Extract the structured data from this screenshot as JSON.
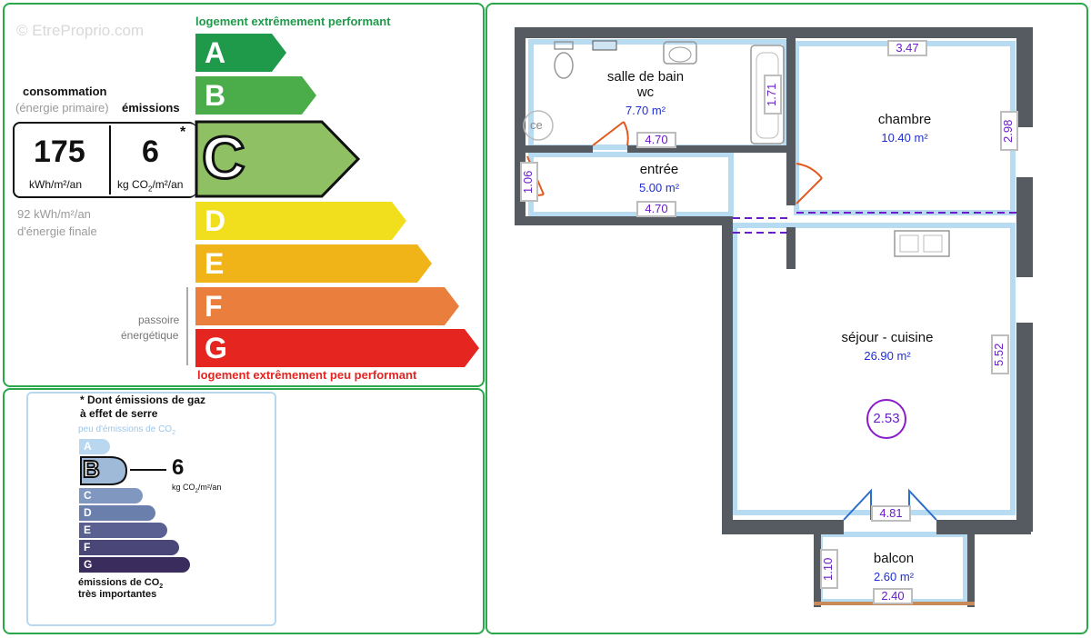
{
  "watermark": "© EtreProprio.com",
  "dpe": {
    "top_label": "logement extrêmement performant",
    "bottom_label": "logement extrêmement peu performant",
    "consumption_title": "consommation",
    "consumption_sub": "(énergie primaire)",
    "emissions_title": "émissions",
    "consumption_value": "175",
    "consumption_unit": "kWh/m²/an",
    "emissions_value": "6",
    "emissions_unit_pre": "kg CO",
    "emissions_unit_sub": "2",
    "emissions_unit_post": "/m²/an",
    "asterisk": "*",
    "final_energy_1": "92 kWh/m²/an",
    "final_energy_2": "d'énergie finale",
    "passoire_1": "passoire",
    "passoire_2": "énergétique",
    "current_class": "C",
    "classes": [
      {
        "letter": "A",
        "color": "#1f9a4a"
      },
      {
        "letter": "B",
        "color": "#4aad4a"
      },
      {
        "letter": "C",
        "color": "#8fc064"
      },
      {
        "letter": "D",
        "color": "#f1df1d"
      },
      {
        "letter": "E",
        "color": "#f0b419"
      },
      {
        "letter": "F",
        "color": "#ea7f3d"
      },
      {
        "letter": "G",
        "color": "#e42520"
      }
    ]
  },
  "ges": {
    "title_1": "* Dont émissions de gaz",
    "title_2": "à effet de serre",
    "top_label_pre": "peu d'émissions de CO",
    "top_label_sub": "2",
    "value": "6",
    "unit_pre": "kg CO",
    "unit_sub": "2",
    "unit_post": "/m²/an",
    "current_class": "B",
    "bottom_label_1_pre": "émissions de CO",
    "bottom_label_1_sub": "2",
    "bottom_label_2": "très importantes",
    "classes": [
      {
        "letter": "A",
        "color": "#b9d8f0"
      },
      {
        "letter": "B",
        "color": "#9fbad9"
      },
      {
        "letter": "C",
        "color": "#8097c0"
      },
      {
        "letter": "D",
        "color": "#6a7fab"
      },
      {
        "letter": "E",
        "color": "#5a6192"
      },
      {
        "letter": "F",
        "color": "#4a4778"
      },
      {
        "letter": "G",
        "color": "#3a2d5e"
      }
    ]
  },
  "plan": {
    "rooms": {
      "sdb_name": "salle de bain",
      "sdb_wc": "wc",
      "sdb_area": "7.70 m²",
      "chambre_name": "chambre",
      "chambre_area": "10.40 m²",
      "entree_name": "entrée",
      "entree_area": "5.00 m²",
      "sejour_name": "séjour - cuisine",
      "sejour_area": "26.90 m²",
      "balcon_name": "balcon",
      "balcon_area": "2.60 m²"
    },
    "dims": {
      "d347": "3.47",
      "d171": "1.71",
      "d298": "2.98",
      "d470a": "4.70",
      "d470b": "4.70",
      "d106": "1.06",
      "d552": "5.52",
      "d481": "4.81",
      "d110": "1.10",
      "d240": "2.40"
    },
    "height_badge": "2.53",
    "ce_label": "ce"
  }
}
